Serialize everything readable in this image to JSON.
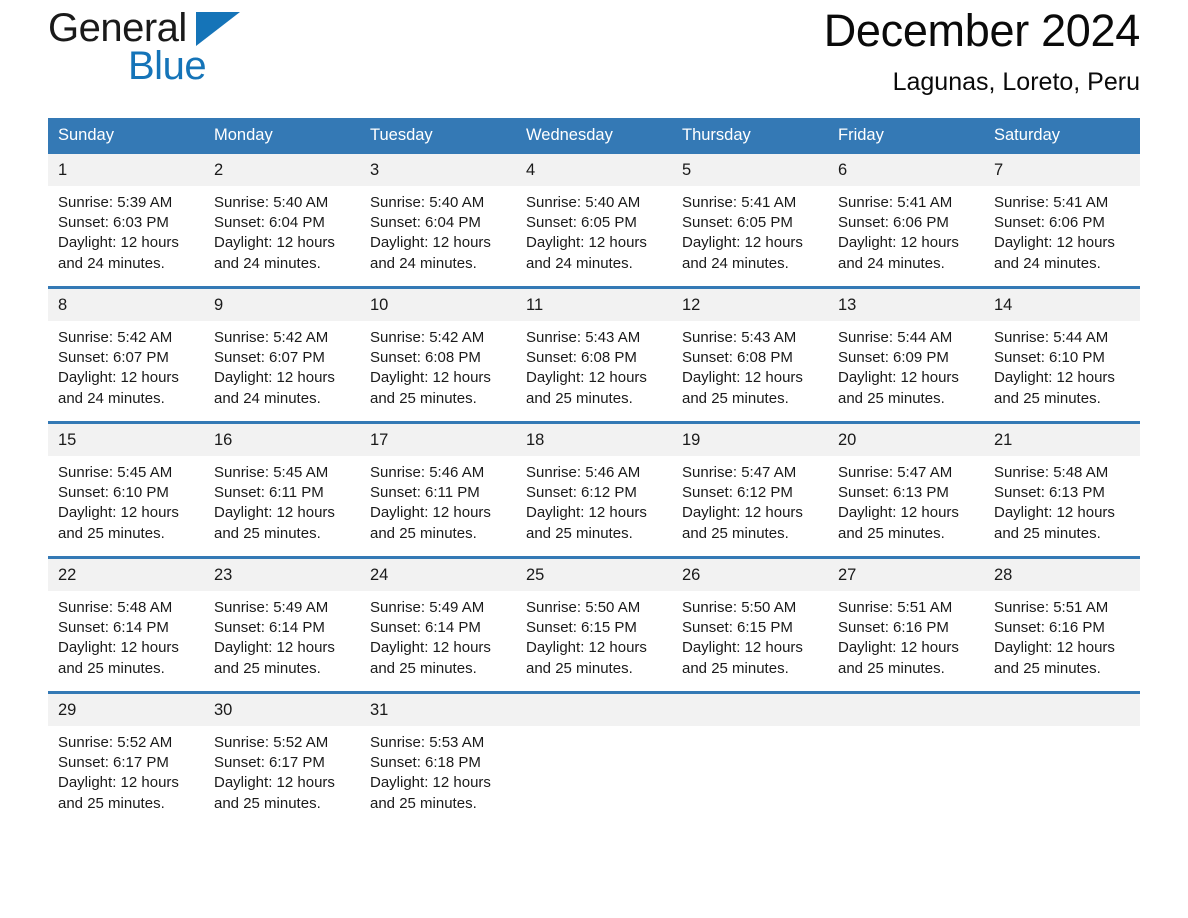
{
  "brand": {
    "name_line1": "General",
    "name_line2": "Blue",
    "accent_color": "#1574b8"
  },
  "header": {
    "month_title": "December 2024",
    "location": "Lagunas, Loreto, Peru"
  },
  "calendar": {
    "header_bg": "#3479b5",
    "daynum_bg": "#f2f2f2",
    "weekday_headers": [
      "Sunday",
      "Monday",
      "Tuesday",
      "Wednesday",
      "Thursday",
      "Friday",
      "Saturday"
    ],
    "weeks": [
      [
        {
          "day": "1",
          "sunrise": "Sunrise: 5:39 AM",
          "sunset": "Sunset: 6:03 PM",
          "daylight": "Daylight: 12 hours and 24 minutes."
        },
        {
          "day": "2",
          "sunrise": "Sunrise: 5:40 AM",
          "sunset": "Sunset: 6:04 PM",
          "daylight": "Daylight: 12 hours and 24 minutes."
        },
        {
          "day": "3",
          "sunrise": "Sunrise: 5:40 AM",
          "sunset": "Sunset: 6:04 PM",
          "daylight": "Daylight: 12 hours and 24 minutes."
        },
        {
          "day": "4",
          "sunrise": "Sunrise: 5:40 AM",
          "sunset": "Sunset: 6:05 PM",
          "daylight": "Daylight: 12 hours and 24 minutes."
        },
        {
          "day": "5",
          "sunrise": "Sunrise: 5:41 AM",
          "sunset": "Sunset: 6:05 PM",
          "daylight": "Daylight: 12 hours and 24 minutes."
        },
        {
          "day": "6",
          "sunrise": "Sunrise: 5:41 AM",
          "sunset": "Sunset: 6:06 PM",
          "daylight": "Daylight: 12 hours and 24 minutes."
        },
        {
          "day": "7",
          "sunrise": "Sunrise: 5:41 AM",
          "sunset": "Sunset: 6:06 PM",
          "daylight": "Daylight: 12 hours and 24 minutes."
        }
      ],
      [
        {
          "day": "8",
          "sunrise": "Sunrise: 5:42 AM",
          "sunset": "Sunset: 6:07 PM",
          "daylight": "Daylight: 12 hours and 24 minutes."
        },
        {
          "day": "9",
          "sunrise": "Sunrise: 5:42 AM",
          "sunset": "Sunset: 6:07 PM",
          "daylight": "Daylight: 12 hours and 24 minutes."
        },
        {
          "day": "10",
          "sunrise": "Sunrise: 5:42 AM",
          "sunset": "Sunset: 6:08 PM",
          "daylight": "Daylight: 12 hours and 25 minutes."
        },
        {
          "day": "11",
          "sunrise": "Sunrise: 5:43 AM",
          "sunset": "Sunset: 6:08 PM",
          "daylight": "Daylight: 12 hours and 25 minutes."
        },
        {
          "day": "12",
          "sunrise": "Sunrise: 5:43 AM",
          "sunset": "Sunset: 6:08 PM",
          "daylight": "Daylight: 12 hours and 25 minutes."
        },
        {
          "day": "13",
          "sunrise": "Sunrise: 5:44 AM",
          "sunset": "Sunset: 6:09 PM",
          "daylight": "Daylight: 12 hours and 25 minutes."
        },
        {
          "day": "14",
          "sunrise": "Sunrise: 5:44 AM",
          "sunset": "Sunset: 6:10 PM",
          "daylight": "Daylight: 12 hours and 25 minutes."
        }
      ],
      [
        {
          "day": "15",
          "sunrise": "Sunrise: 5:45 AM",
          "sunset": "Sunset: 6:10 PM",
          "daylight": "Daylight: 12 hours and 25 minutes."
        },
        {
          "day": "16",
          "sunrise": "Sunrise: 5:45 AM",
          "sunset": "Sunset: 6:11 PM",
          "daylight": "Daylight: 12 hours and 25 minutes."
        },
        {
          "day": "17",
          "sunrise": "Sunrise: 5:46 AM",
          "sunset": "Sunset: 6:11 PM",
          "daylight": "Daylight: 12 hours and 25 minutes."
        },
        {
          "day": "18",
          "sunrise": "Sunrise: 5:46 AM",
          "sunset": "Sunset: 6:12 PM",
          "daylight": "Daylight: 12 hours and 25 minutes."
        },
        {
          "day": "19",
          "sunrise": "Sunrise: 5:47 AM",
          "sunset": "Sunset: 6:12 PM",
          "daylight": "Daylight: 12 hours and 25 minutes."
        },
        {
          "day": "20",
          "sunrise": "Sunrise: 5:47 AM",
          "sunset": "Sunset: 6:13 PM",
          "daylight": "Daylight: 12 hours and 25 minutes."
        },
        {
          "day": "21",
          "sunrise": "Sunrise: 5:48 AM",
          "sunset": "Sunset: 6:13 PM",
          "daylight": "Daylight: 12 hours and 25 minutes."
        }
      ],
      [
        {
          "day": "22",
          "sunrise": "Sunrise: 5:48 AM",
          "sunset": "Sunset: 6:14 PM",
          "daylight": "Daylight: 12 hours and 25 minutes."
        },
        {
          "day": "23",
          "sunrise": "Sunrise: 5:49 AM",
          "sunset": "Sunset: 6:14 PM",
          "daylight": "Daylight: 12 hours and 25 minutes."
        },
        {
          "day": "24",
          "sunrise": "Sunrise: 5:49 AM",
          "sunset": "Sunset: 6:14 PM",
          "daylight": "Daylight: 12 hours and 25 minutes."
        },
        {
          "day": "25",
          "sunrise": "Sunrise: 5:50 AM",
          "sunset": "Sunset: 6:15 PM",
          "daylight": "Daylight: 12 hours and 25 minutes."
        },
        {
          "day": "26",
          "sunrise": "Sunrise: 5:50 AM",
          "sunset": "Sunset: 6:15 PM",
          "daylight": "Daylight: 12 hours and 25 minutes."
        },
        {
          "day": "27",
          "sunrise": "Sunrise: 5:51 AM",
          "sunset": "Sunset: 6:16 PM",
          "daylight": "Daylight: 12 hours and 25 minutes."
        },
        {
          "day": "28",
          "sunrise": "Sunrise: 5:51 AM",
          "sunset": "Sunset: 6:16 PM",
          "daylight": "Daylight: 12 hours and 25 minutes."
        }
      ],
      [
        {
          "day": "29",
          "sunrise": "Sunrise: 5:52 AM",
          "sunset": "Sunset: 6:17 PM",
          "daylight": "Daylight: 12 hours and 25 minutes."
        },
        {
          "day": "30",
          "sunrise": "Sunrise: 5:52 AM",
          "sunset": "Sunset: 6:17 PM",
          "daylight": "Daylight: 12 hours and 25 minutes."
        },
        {
          "day": "31",
          "sunrise": "Sunrise: 5:53 AM",
          "sunset": "Sunset: 6:18 PM",
          "daylight": "Daylight: 12 hours and 25 minutes."
        },
        {
          "day": "",
          "sunrise": "",
          "sunset": "",
          "daylight": ""
        },
        {
          "day": "",
          "sunrise": "",
          "sunset": "",
          "daylight": ""
        },
        {
          "day": "",
          "sunrise": "",
          "sunset": "",
          "daylight": ""
        },
        {
          "day": "",
          "sunrise": "",
          "sunset": "",
          "daylight": ""
        }
      ]
    ]
  }
}
